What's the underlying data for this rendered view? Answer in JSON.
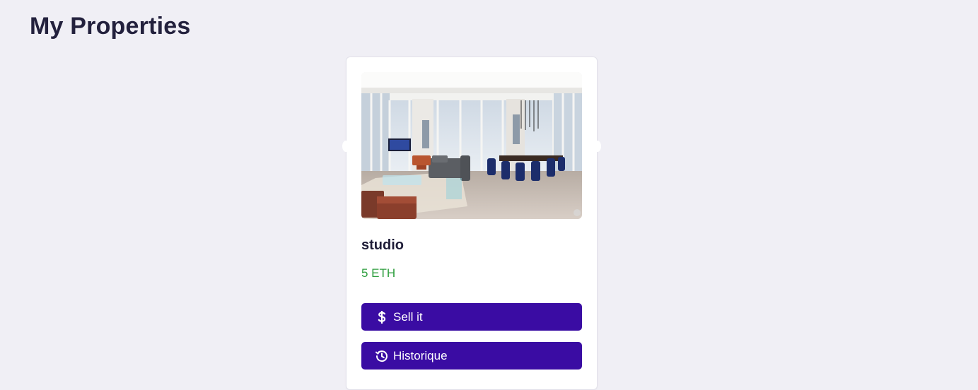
{
  "page": {
    "title": "My Properties"
  },
  "properties": [
    {
      "name": "studio",
      "price": "5 ETH",
      "image": "apartment-living-room-photo",
      "actions": {
        "sell_label": "Sell it",
        "sell_icon": "dollar-icon",
        "history_label": "Historique",
        "history_icon": "history-icon"
      }
    }
  ],
  "colors": {
    "background": "#f0eff5",
    "button": "#3a0ca3",
    "price": "#2e9e3e",
    "title": "#23213d"
  }
}
